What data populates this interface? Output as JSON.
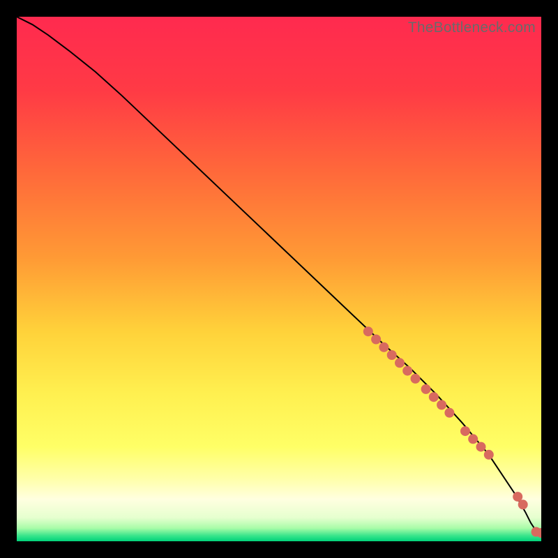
{
  "watermark": "TheBottleneck.com",
  "colors": {
    "gradient_stops": [
      {
        "offset": 0.0,
        "color": "#ff2a4f"
      },
      {
        "offset": 0.14,
        "color": "#ff3a45"
      },
      {
        "offset": 0.3,
        "color": "#ff6a3a"
      },
      {
        "offset": 0.46,
        "color": "#ff9a35"
      },
      {
        "offset": 0.6,
        "color": "#ffd23a"
      },
      {
        "offset": 0.72,
        "color": "#fff050"
      },
      {
        "offset": 0.82,
        "color": "#ffff66"
      },
      {
        "offset": 0.88,
        "color": "#ffffa8"
      },
      {
        "offset": 0.92,
        "color": "#ffffe0"
      },
      {
        "offset": 0.955,
        "color": "#e6ffcf"
      },
      {
        "offset": 0.975,
        "color": "#a8fca8"
      },
      {
        "offset": 0.99,
        "color": "#35e48a"
      },
      {
        "offset": 1.0,
        "color": "#00d27a"
      }
    ],
    "line": "#000000",
    "marker": "#d86a5f",
    "background": "#000000"
  },
  "chart_data": {
    "type": "line",
    "title": "",
    "xlabel": "",
    "ylabel": "",
    "xlim": [
      0,
      100
    ],
    "ylim": [
      0,
      100
    ],
    "series": [
      {
        "name": "curve",
        "x": [
          0,
          3,
          6,
          10,
          15,
          20,
          30,
          40,
          50,
          60,
          70,
          75,
          80,
          85,
          90,
          93,
          95,
          97,
          98,
          99,
          100
        ],
        "y": [
          100,
          98.5,
          96.5,
          93.5,
          89.5,
          85,
          75.5,
          66,
          56.5,
          47,
          37.5,
          33,
          28,
          22.5,
          16.5,
          12,
          9,
          5.5,
          3.5,
          2,
          1.5
        ]
      }
    ],
    "markers": {
      "name": "highlighted-points",
      "x": [
        67,
        68.5,
        70,
        71.5,
        73,
        74.5,
        76,
        78,
        79.5,
        81,
        82.5,
        85.5,
        87,
        88.5,
        90,
        95.5,
        96.5,
        99,
        100
      ],
      "y": [
        40,
        38.5,
        37,
        35.5,
        34,
        32.5,
        31,
        29,
        27.5,
        26,
        24.5,
        21,
        19.5,
        18,
        16.5,
        8.5,
        7,
        1.8,
        1.6
      ]
    }
  }
}
